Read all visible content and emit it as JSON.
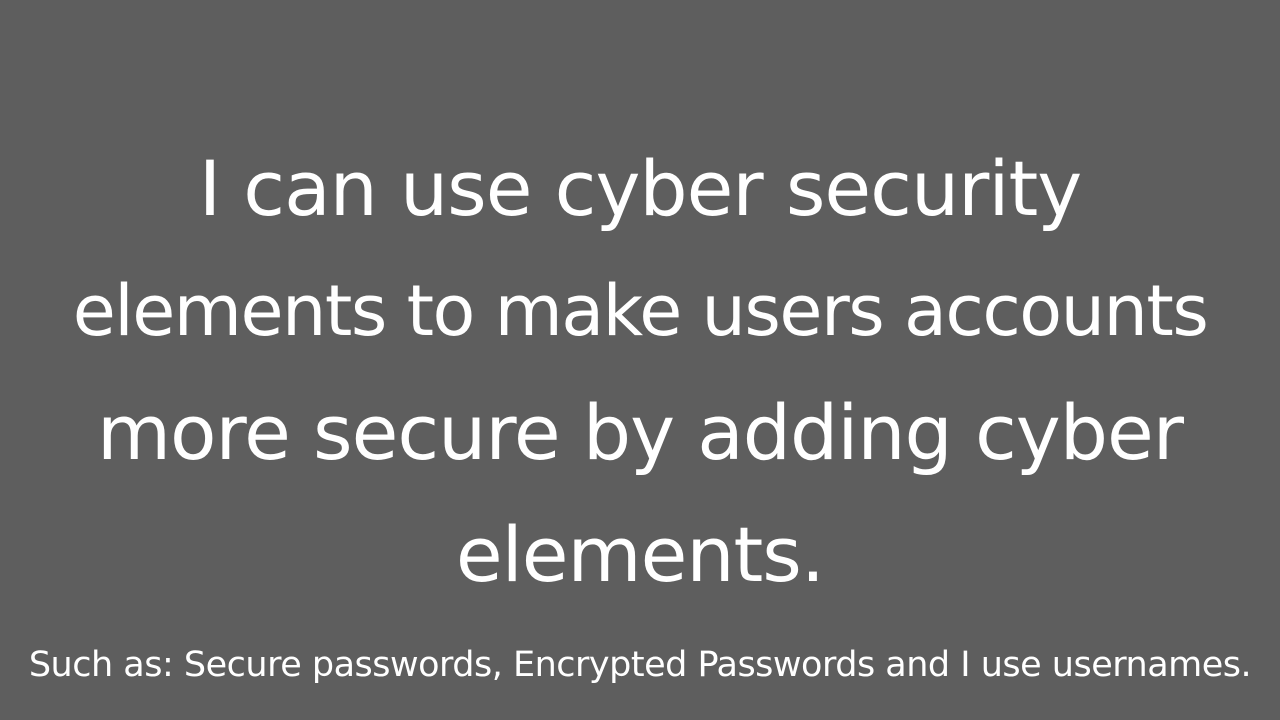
{
  "slide": {
    "background_color": "#5e5e5e",
    "text_color": "#ffffff",
    "headline": {
      "lines": [
        "I can use cyber security",
        "elements to make users accounts",
        "more secure by adding cyber",
        "elements."
      ]
    },
    "subtext": "Such as: Secure passwords, Encrypted Passwords and I use usernames."
  }
}
